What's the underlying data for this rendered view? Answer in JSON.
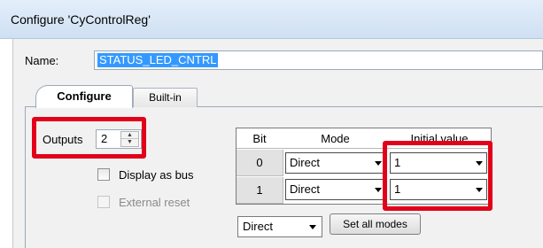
{
  "window": {
    "title": "Configure 'CyControlReg'"
  },
  "name_field": {
    "label": "Name:",
    "value": "STATUS_LED_CNTRL"
  },
  "tabs": [
    {
      "label": "Configure",
      "active": true
    },
    {
      "label": "Built-in",
      "active": false
    }
  ],
  "outputs": {
    "label": "Outputs",
    "value": "2"
  },
  "checkboxes": {
    "display_as_bus": {
      "label": "Display as bus",
      "checked": false,
      "enabled": true
    },
    "external_reset": {
      "label": "External reset",
      "checked": false,
      "enabled": false
    }
  },
  "table": {
    "columns": [
      "Bit",
      "Mode",
      "Initial value"
    ],
    "rows": [
      {
        "bit": "0",
        "mode": "Direct",
        "initial": "1"
      },
      {
        "bit": "1",
        "mode": "Direct",
        "initial": "1"
      }
    ]
  },
  "set_all": {
    "mode_value": "Direct",
    "button_label": "Set all modes"
  },
  "colors": {
    "highlight": "#e2001a",
    "selection": "#3399ff",
    "titlebar": "#d6e5f5"
  }
}
